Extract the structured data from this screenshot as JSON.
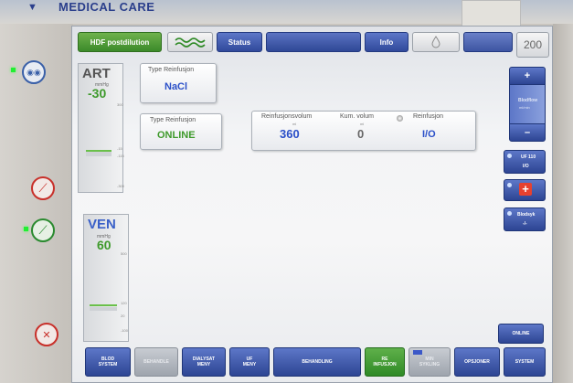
{
  "brand": "MEDICAL CARE",
  "topbar": {
    "mode": "HDF postdilution",
    "status": "Status",
    "info": "Info",
    "volume_display": "200"
  },
  "gauges": {
    "art": {
      "label": "ART",
      "unit": "mmHg",
      "value": "-30",
      "ticks": [
        "300",
        "-15",
        "-115",
        "-300"
      ]
    },
    "ven": {
      "label": "VEN",
      "unit": "mmHg",
      "value": "60",
      "ticks": [
        "500",
        "120",
        "20",
        "-100"
      ]
    }
  },
  "reinfusion_type_1": {
    "label": "Type Reinfusjon",
    "value": "NaCl"
  },
  "reinfusion_type_2": {
    "label": "Type Reinfusjon",
    "value": "ONLINE"
  },
  "reinfusion_panel": {
    "volume_label": "Reinfusjonsvolum",
    "volume_unit": "ml",
    "volume_value": "360",
    "kum_label": "Kum. volum",
    "kum_unit": "ml",
    "kum_value": "0",
    "reinf_label": "Reinfusjon",
    "reinf_value": "I/O"
  },
  "right": {
    "plus": "+",
    "minus": "–",
    "bloodflow_label": "Blodflow",
    "bloodflow_unit": "ml/min",
    "uf_label": "UF 110",
    "uf_value": "I/O",
    "bloodsyk_label": "Blodsyk",
    "bloodsyk_value": "-/-",
    "online": "ONLINE"
  },
  "bottom": {
    "b1": "BLOD\nSYSTEM",
    "b2": "BEHANDLE",
    "b3": "DIALYSAT\nMENY",
    "b4": "UF\nMENY",
    "b5": "BEHANDLING",
    "b6": "RE\nINFUSJON",
    "b7": "MIN\nSYKLING",
    "b8": "OPSJONER",
    "b9": "SYSTEM"
  },
  "colors": {
    "accent_blue": "#30499b",
    "accent_green": "#3e9a2b",
    "led_green": "#22ee33"
  }
}
